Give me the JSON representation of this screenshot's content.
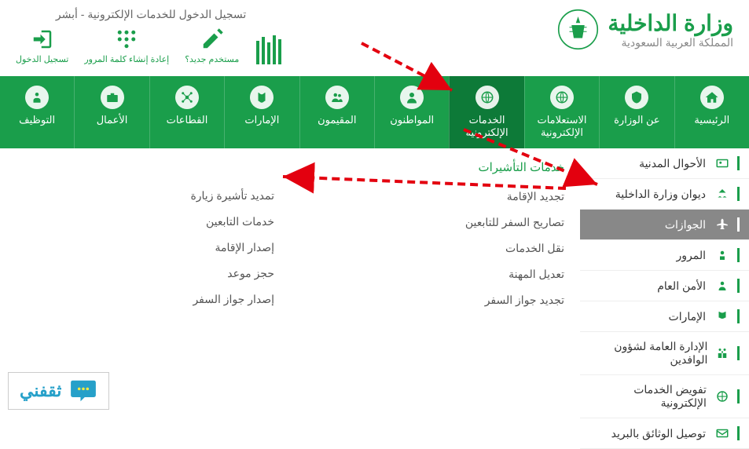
{
  "header": {
    "title": "وزارة الداخلية",
    "subtitle": "المملكة العربية السعودية",
    "absher_title": "تسجيل الدخول للخدمات الإلكترونية - أبشر",
    "absher_items": [
      {
        "label": "مستخدم جديد؟"
      },
      {
        "label": "إعادة إنشاء كلمة المرور"
      },
      {
        "label": "تسجيل الدخول"
      }
    ]
  },
  "nav": [
    {
      "label": "الرئيسية"
    },
    {
      "label": "عن الوزارة"
    },
    {
      "label": "الاستعلامات الإلكترونية"
    },
    {
      "label": "الخدمات الإلكترونية"
    },
    {
      "label": "المواطنون"
    },
    {
      "label": "المقيمون"
    },
    {
      "label": "الإمارات"
    },
    {
      "label": "القطاعات"
    },
    {
      "label": "الأعمال"
    },
    {
      "label": "التوظيف"
    }
  ],
  "sidebar": [
    {
      "label": "الأحوال المدنية"
    },
    {
      "label": "ديوان وزارة الداخلية"
    },
    {
      "label": "الجوازات"
    },
    {
      "label": "المرور"
    },
    {
      "label": "الأمن العام"
    },
    {
      "label": "الإمارات"
    },
    {
      "label": "الإدارة العامة لشؤون الوافدين"
    },
    {
      "label": "تفويض الخدمات الإلكترونية"
    },
    {
      "label": "توصيل الوثائق بالبريد"
    }
  ],
  "panels": {
    "col1_title": "خدمات التأشيرات",
    "col1": [
      "تجديد الإقامة",
      "تصاريح السفر للتابعين",
      "نقل الخدمات",
      "تعديل المهنة",
      "تجديد جواز السفر"
    ],
    "col2": [
      "تمديد تأشيرة زيارة",
      "خدمات التابعين",
      "إصدار الإقامة",
      "حجز موعد",
      "إصدار جواز السفر"
    ]
  },
  "footer": {
    "brand": "ثقفني"
  }
}
